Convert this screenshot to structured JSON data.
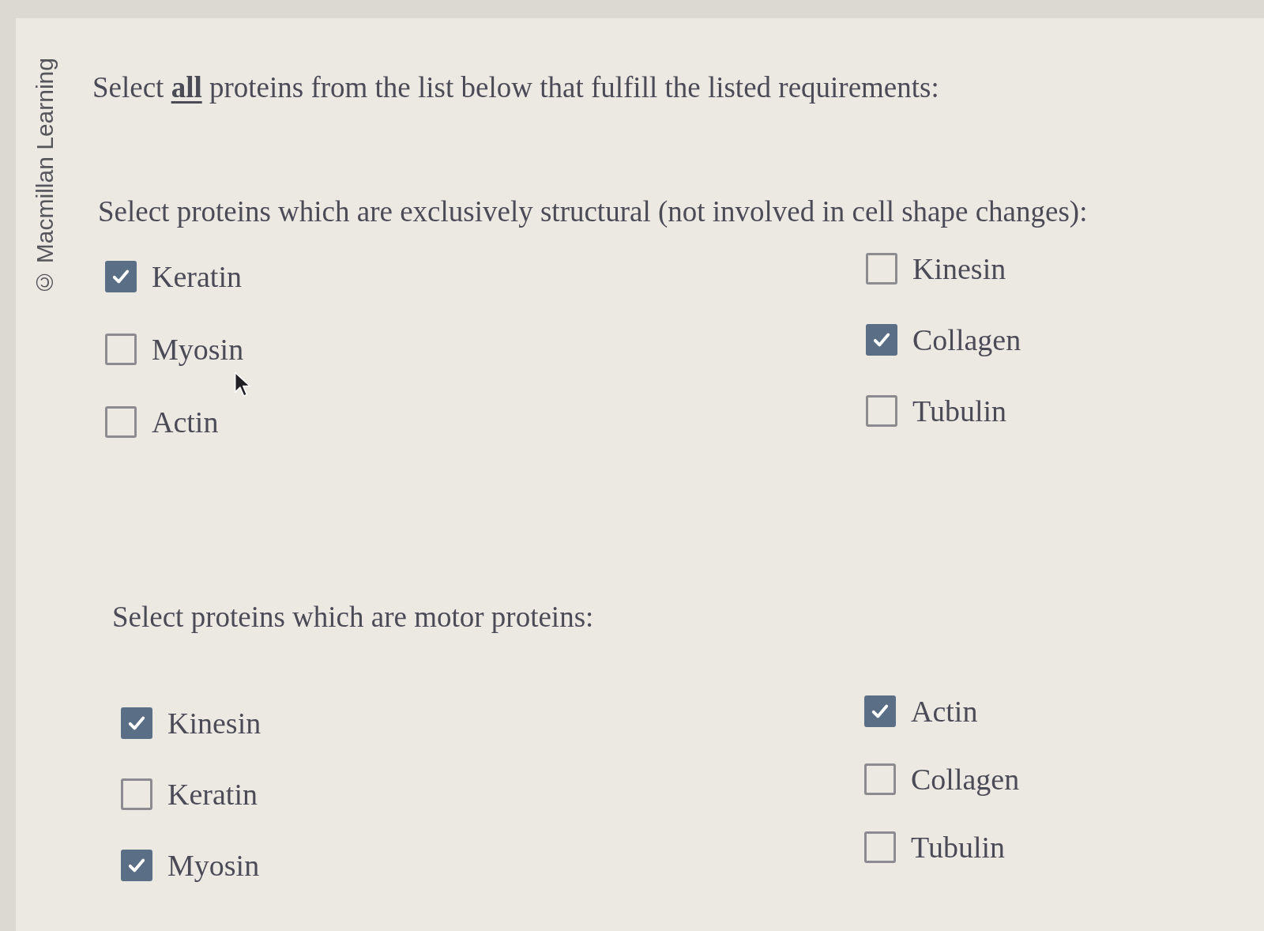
{
  "copyright": "© Macmillan Learning",
  "instruction": "Select **all** proteins from the list below that fulfill the listed requirements:",
  "sections": [
    {
      "prompt": "Select proteins which are exclusively structural (not involved in cell shape changes):",
      "columns": [
        {
          "options": [
            {
              "label": "Keratin",
              "checked": true
            },
            {
              "label": "Myosin",
              "checked": false
            },
            {
              "label": "Actin",
              "checked": false
            }
          ]
        },
        {
          "options": [
            {
              "label": "Kinesin",
              "checked": false
            },
            {
              "label": "Collagen",
              "checked": true
            },
            {
              "label": "Tubulin",
              "checked": false
            }
          ]
        }
      ]
    },
    {
      "prompt": "Select proteins which are motor proteins:",
      "columns": [
        {
          "options": [
            {
              "label": "Kinesin",
              "checked": true
            },
            {
              "label": "Keratin",
              "checked": false
            },
            {
              "label": "Myosin",
              "checked": true
            }
          ]
        },
        {
          "options": [
            {
              "label": "Actin",
              "checked": true
            },
            {
              "label": "Collagen",
              "checked": false
            },
            {
              "label": "Tubulin",
              "checked": false
            }
          ]
        }
      ]
    }
  ]
}
